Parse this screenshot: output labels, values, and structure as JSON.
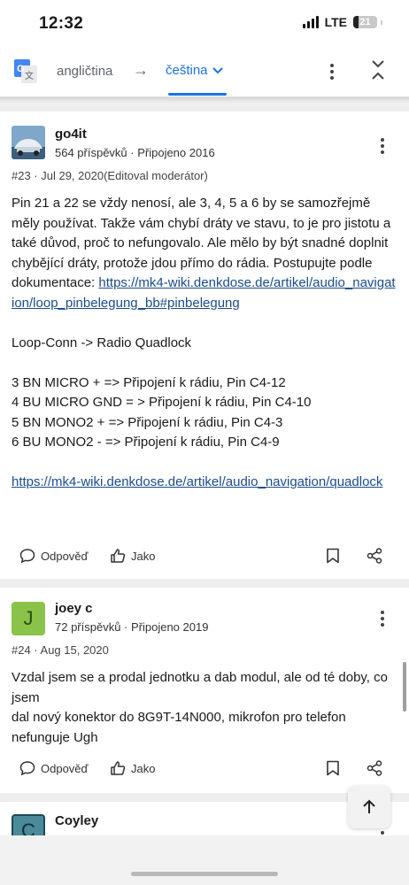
{
  "status_bar": {
    "time": "12:32",
    "network": "LTE",
    "battery": "21",
    "battery_level": 0.21
  },
  "translate_bar": {
    "icon": "google-translate-icon",
    "source_language": "angličtina",
    "arrow": "→",
    "target_language": "čeština",
    "menu_icon": "more-vert-icon",
    "collapse_icon": "collapse-icon"
  },
  "posts": [
    {
      "username": "go4it",
      "stats": "564 příspěvků · Připojeno 2016",
      "meta": "#23 · Jul 29, 2020(Editoval moderátor)",
      "body_intro": "Pin 21 a 22 se vždy nenosí, ale 3, 4, 5 a 6 by se samozřejmě měly používat. Takže vám chybí dráty ve stavu, to je pro jistotu a také důvod, proč to nefungovalo. Ale mělo by být snadné doplnit chybějící dráty, protože jdou přímo do rádia. Postupujte podle dokumentace: ",
      "link1": "https://mk4-wiki.denkdose.de/artikel/audio_navigation/loop_pinbelegung_bb#pinbelegung",
      "line_loop": "Loop-Conn -> Radio Quadlock",
      "pins": [
        "3 BN MICRO + => Připojení k rádiu, Pin C4-12",
        "4 BU MICRO GND = > Připojení k rádiu, Pin C4-10",
        "5 BN MONO2 + => Připojení k rádiu, Pin C4-3",
        "6 BU MONO2 - => Připojení k rádiu, Pin C4-9"
      ],
      "link2": "https://mk4-wiki.denkdose.de/artikel/audio_navigation/quadlock",
      "reply_label": "Odpověď",
      "like_label": "Jako"
    },
    {
      "username": "joey c",
      "avatar_letter": "J",
      "stats": "72 příspěvků · Připojeno 2019",
      "meta": "#24 · Aug 15, 2020",
      "body_line1": "Vzdal jsem se a prodal jednotku a dab modul, ale od té doby, co jsem",
      "body_line2": "dal nový konektor do 8G9T-14N000, mikrofon pro telefon nefunguje Ugh",
      "reply_label": "Odpověď",
      "like_label": "Jako"
    },
    {
      "username": "Coyley",
      "avatar_letter": "C"
    }
  ],
  "colors": {
    "accent": "#1a73e8",
    "link": "#1a4c8b",
    "avatar_joey": "#8bc34a",
    "avatar_coyley": "#4a8a99"
  }
}
